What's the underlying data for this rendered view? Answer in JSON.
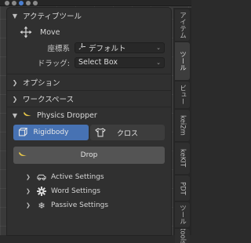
{
  "panel": {
    "active_tool": {
      "title": "アクティブツール",
      "tool_name": "Move",
      "properties": [
        {
          "label": "座標系",
          "value": "デフォルト"
        },
        {
          "label": "ドラッグ:",
          "value": "Select Box"
        }
      ]
    },
    "options_title": "オプション",
    "workspace_title": "ワークスペース",
    "physics_dropper": {
      "title": "Physics Dropper",
      "mode_buttons": [
        {
          "label": "Rigidbody",
          "active": true
        },
        {
          "label": "クロス",
          "active": false
        }
      ],
      "drop_label": "Drop",
      "subpanels": [
        {
          "label": "Active Settings",
          "icon": "car-icon"
        },
        {
          "label": "Word Settings",
          "icon": "gear-icon"
        },
        {
          "label": "Passive Settings",
          "icon": "snowflake-icon"
        }
      ]
    }
  },
  "side_tabs": [
    {
      "label": "アイテム",
      "active": false
    },
    {
      "label": "ツール",
      "active": true
    },
    {
      "label": "ビュー",
      "active": false
    },
    {
      "label": "kei2m",
      "active": false
    },
    {
      "label": "keKIT",
      "active": false
    },
    {
      "label": "PDT",
      "active": false
    },
    {
      "label": "ツール",
      "active": false
    },
    {
      "label": "tools",
      "active": false
    }
  ],
  "colors": {
    "accent": "#4772b3",
    "panel_bg": "#303030",
    "button_bg": "#545454"
  }
}
